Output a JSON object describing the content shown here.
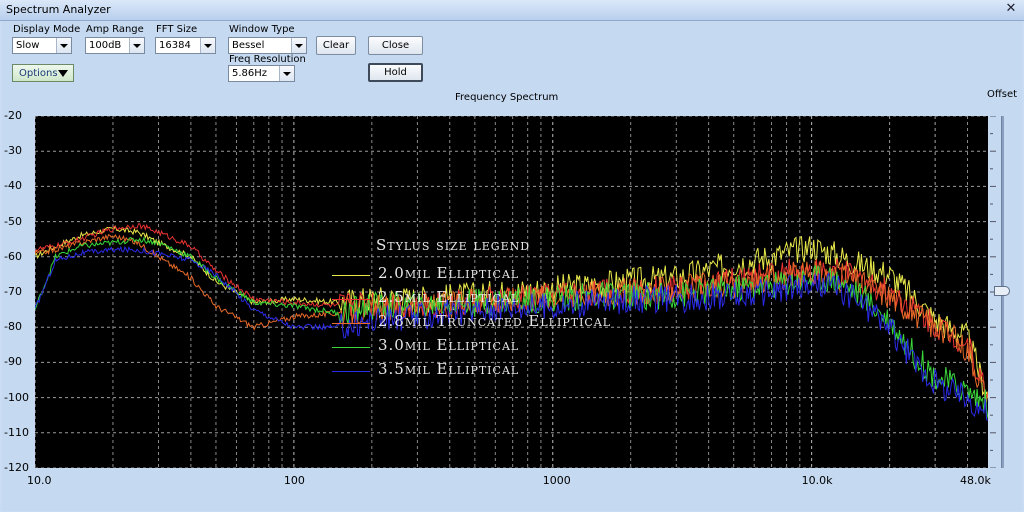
{
  "window": {
    "title": "Spectrum Analyzer",
    "close_glyph": "✕"
  },
  "controls": {
    "display_mode": {
      "label": "Display Mode",
      "value": "Slow"
    },
    "amp_range": {
      "label": "Amp Range",
      "value": "100dB"
    },
    "fft_size": {
      "label": "FFT Size",
      "value": "16384"
    },
    "window_type": {
      "label": "Window Type",
      "value": "Bessel"
    },
    "freq_resolution": {
      "label": "Freq Resolution",
      "value": "5.86Hz"
    },
    "clear_label": "Clear",
    "close_label": "Close",
    "hold_label": "Hold",
    "options_label": "Options"
  },
  "plot": {
    "title": "Frequency Spectrum",
    "offset_label": "Offset"
  },
  "chart_data": {
    "type": "line",
    "title": "Frequency Spectrum",
    "x_scale": "log",
    "xlim": [
      10,
      48000
    ],
    "ylim": [
      -120,
      -20
    ],
    "x_tick_labels": [
      "10.0",
      "100",
      "1000",
      "10.0k",
      "48.0k"
    ],
    "y_tick_labels": [
      "-20",
      "-30",
      "-40",
      "-50",
      "-60",
      "-70",
      "-80",
      "-90",
      "-100",
      "-110",
      "-120"
    ],
    "grid": true,
    "legend_title": "Stylus size legend",
    "series": [
      {
        "name": "2.0mil Elliptical",
        "color": "#e8e84a",
        "x": [
          10,
          12,
          15,
          20,
          25,
          30,
          40,
          50,
          70,
          100,
          150,
          200,
          300,
          500,
          700,
          1000,
          1500,
          2000,
          3000,
          5000,
          7000,
          10000,
          12000,
          15000,
          20000,
          25000,
          30000,
          40000,
          48000
        ],
        "y": [
          -60,
          -57,
          -54,
          -52,
          -53,
          -56,
          -60,
          -67,
          -73,
          -72,
          -73,
          -72,
          -72,
          -71,
          -70,
          -69,
          -68,
          -67,
          -66,
          -62,
          -60,
          -57,
          -59,
          -62,
          -65,
          -72,
          -78,
          -83,
          -100
        ]
      },
      {
        "name": "2.5mil Elliptical",
        "color": "#e83232",
        "x": [
          10,
          12,
          15,
          20,
          25,
          30,
          40,
          50,
          70,
          100,
          150,
          200,
          300,
          500,
          700,
          1000,
          1500,
          2000,
          3000,
          5000,
          7000,
          10000,
          12000,
          15000,
          20000,
          25000,
          30000,
          40000,
          48000
        ],
        "y": [
          -58,
          -57,
          -55,
          -52,
          -51,
          -53,
          -57,
          -64,
          -72,
          -73,
          -74,
          -73,
          -74,
          -73,
          -72,
          -71,
          -70,
          -70,
          -69,
          -67,
          -65,
          -64,
          -64,
          -66,
          -70,
          -75,
          -79,
          -85,
          -100
        ]
      },
      {
        "name": "2.8mil Truncated Elliptical",
        "color": "#e86a2a",
        "x": [
          10,
          12,
          15,
          20,
          25,
          30,
          40,
          50,
          70,
          100,
          150,
          200,
          300,
          500,
          700,
          1000,
          1500,
          2000,
          3000,
          5000,
          7000,
          10000,
          12000,
          15000,
          20000,
          25000,
          30000,
          40000,
          48000
        ],
        "y": [
          -59,
          -58,
          -56,
          -54,
          -56,
          -60,
          -66,
          -74,
          -80,
          -77,
          -76,
          -75,
          -74,
          -73,
          -72,
          -71,
          -70,
          -70,
          -69,
          -68,
          -66,
          -65,
          -65,
          -67,
          -71,
          -76,
          -80,
          -86,
          -101
        ]
      },
      {
        "name": "3.0mil Elliptical",
        "color": "#3ad83a",
        "x": [
          10,
          12,
          15,
          20,
          25,
          30,
          40,
          50,
          70,
          100,
          150,
          200,
          300,
          500,
          700,
          1000,
          1500,
          2000,
          3000,
          5000,
          7000,
          10000,
          12000,
          15000,
          20000,
          25000,
          30000,
          40000,
          48000
        ],
        "y": [
          -75,
          -60,
          -57,
          -56,
          -55,
          -56,
          -60,
          -66,
          -73,
          -74,
          -76,
          -74,
          -74,
          -73,
          -72,
          -72,
          -71,
          -71,
          -71,
          -69,
          -68,
          -66,
          -66,
          -70,
          -78,
          -88,
          -94,
          -98,
          -102
        ]
      },
      {
        "name": "3.5mil Elliptical",
        "color": "#2a2ae8",
        "x": [
          10,
          12,
          15,
          20,
          25,
          30,
          40,
          50,
          70,
          100,
          150,
          200,
          300,
          500,
          700,
          1000,
          1500,
          2000,
          3000,
          5000,
          7000,
          10000,
          12000,
          15000,
          20000,
          25000,
          30000,
          40000,
          48000
        ],
        "y": [
          -75,
          -61,
          -59,
          -58,
          -58,
          -59,
          -61,
          -65,
          -75,
          -80,
          -80,
          -78,
          -77,
          -75,
          -74,
          -74,
          -73,
          -72,
          -72,
          -71,
          -70,
          -68,
          -68,
          -72,
          -80,
          -90,
          -96,
          -100,
          -104
        ]
      }
    ]
  }
}
